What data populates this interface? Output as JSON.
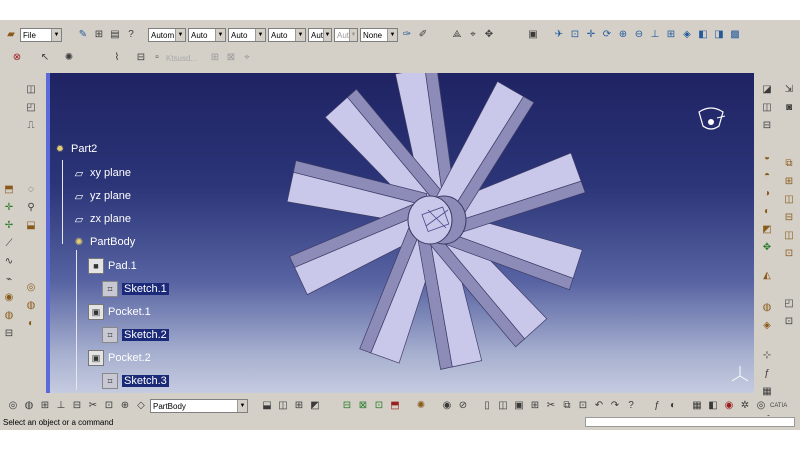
{
  "toolbar_top": {
    "file_combo": "File",
    "combo_1": "Autom",
    "combo_2": "Auto",
    "combo_3": "Auto",
    "combo_4": "Auto",
    "combo_5": "Aut",
    "combo_6": "Aut",
    "combo_7": "None"
  },
  "toolbar_second": {
    "faded_label": "Ktsusd..."
  },
  "tree": {
    "root": "Part2",
    "planes": [
      "xy plane",
      "yz plane",
      "zx plane"
    ],
    "body": "PartBody",
    "features": [
      {
        "label": "Pad.1",
        "sketch": "Sketch.1"
      },
      {
        "label": "Pocket.1",
        "sketch": "Sketch.2"
      },
      {
        "label": "Pocket.2",
        "sketch": "Sketch.3"
      }
    ]
  },
  "bottom_toolbar": {
    "body_combo": "PartBody",
    "catia_label": "CATIA"
  },
  "status": {
    "message": "Select an object or a command"
  },
  "colors": {
    "viewport_top": "#1f2363",
    "viewport_bottom": "#c5cbe0",
    "part_face": "#c9c8ea",
    "part_side": "#8d8bb8",
    "selection": "#1b2a78",
    "toolbar": "#d4d0c8"
  }
}
